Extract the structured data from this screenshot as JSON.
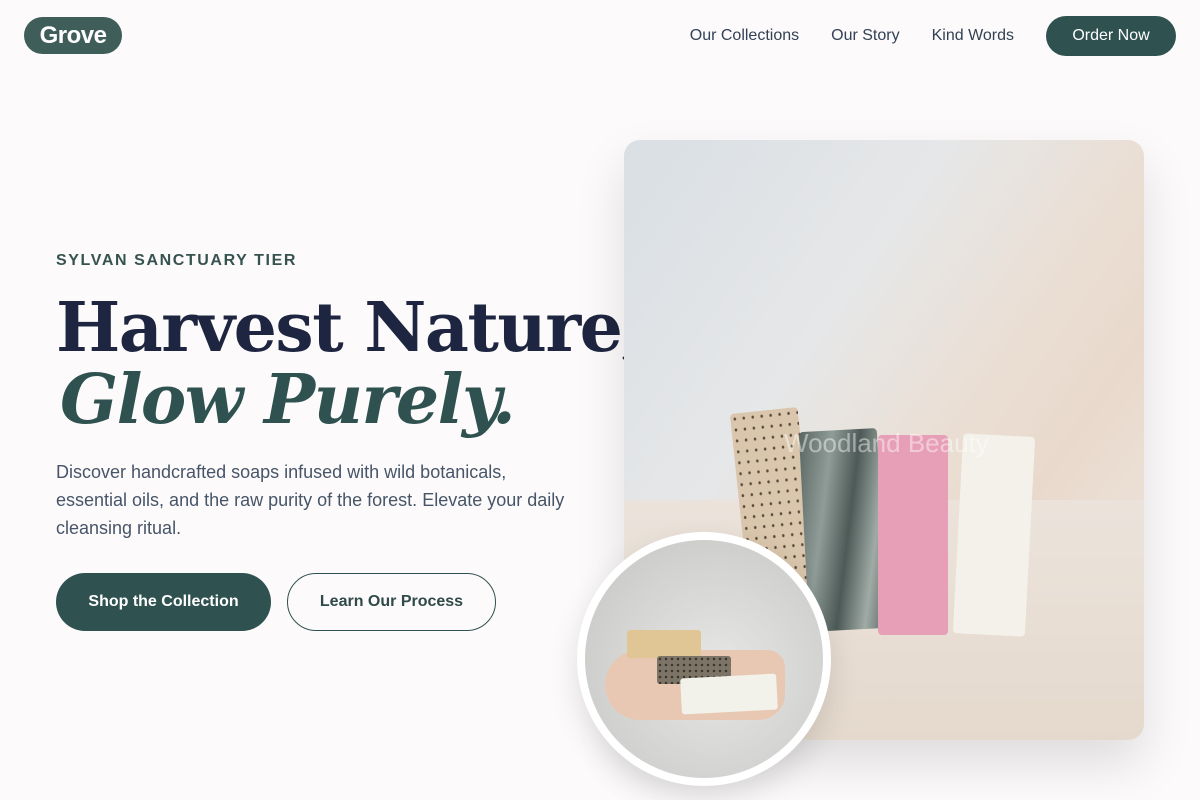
{
  "header": {
    "logo": "Grove",
    "nav": [
      "Our Collections",
      "Our Story",
      "Kind Words"
    ],
    "cta": "Order Now"
  },
  "hero": {
    "eyebrow": "SYLVAN SANCTUARY TIER",
    "title_line1": "Harvest Nature,",
    "title_line2": "Glow Purely.",
    "description": "Discover handcrafted soaps infused with wild botanicals, essential oils, and the raw purity of the forest. Elevate your daily cleansing ritual.",
    "primary_button": "Shop the Collection",
    "secondary_button": "Learn Our Process"
  },
  "images": {
    "main_watermark": "Woodland Beauty"
  },
  "colors": {
    "brand": "#2f5250",
    "title": "#1e2540",
    "background": "#fcfafa"
  }
}
